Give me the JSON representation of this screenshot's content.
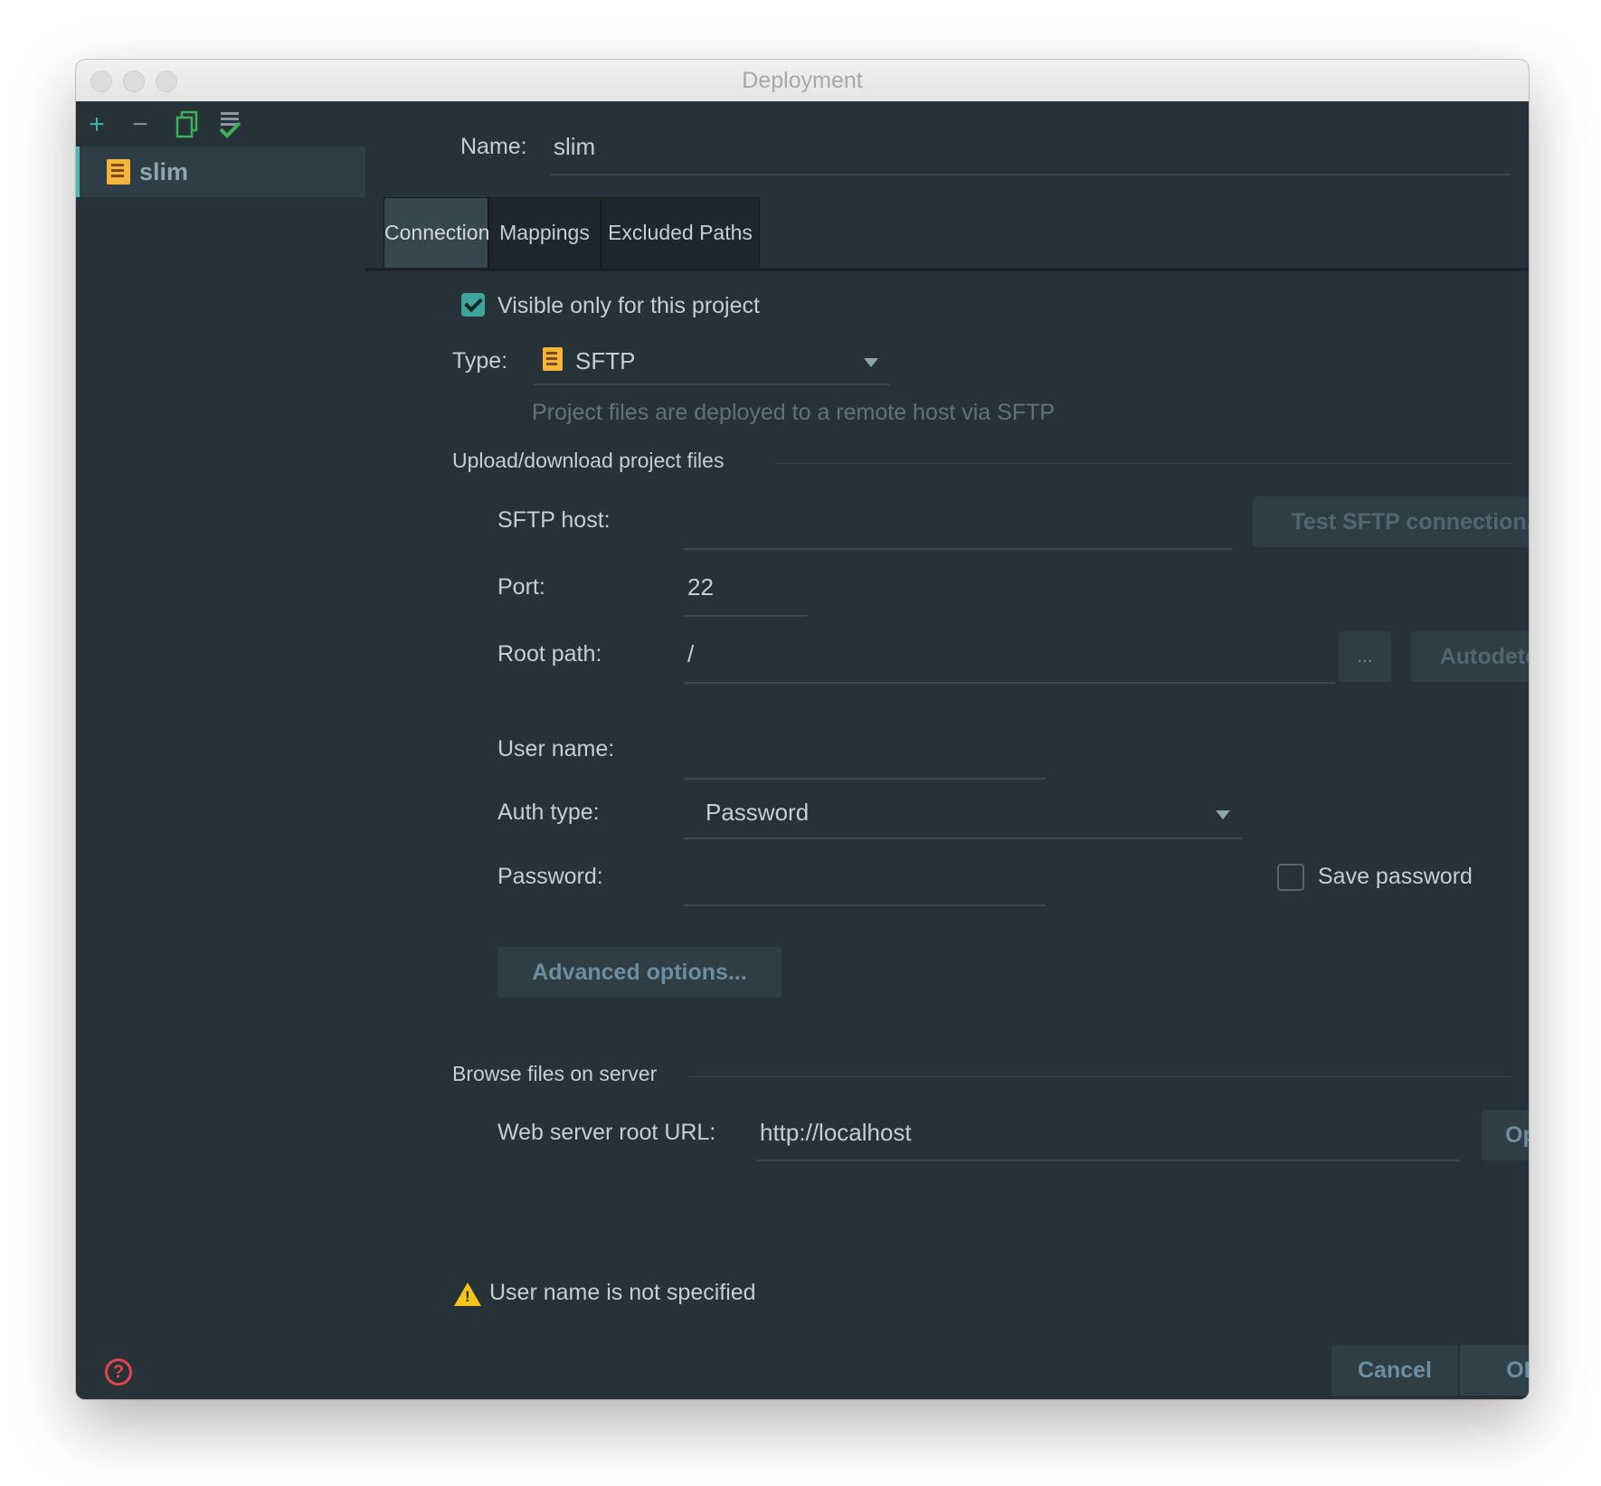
{
  "window": {
    "title": "Deployment"
  },
  "toolbar": {
    "icons": [
      "plus-icon",
      "minus-icon",
      "copy-icon",
      "set-default-icon"
    ],
    "add_glyph": "+",
    "remove_glyph": "−"
  },
  "sidebar": {
    "items": [
      {
        "label": "slim",
        "icon": "sftp-server-icon"
      }
    ]
  },
  "form": {
    "name_label": "Name:",
    "name_value": "slim",
    "tabs": [
      {
        "label": "Connection",
        "active": true
      },
      {
        "label": "Mappings",
        "active": false
      },
      {
        "label": "Excluded Paths",
        "active": false
      }
    ],
    "visible_only_label": "Visible only for this project",
    "visible_only_checked": true,
    "type_label": "Type:",
    "type_value": "SFTP",
    "type_hint": "Project files are deployed to a remote host via SFTP",
    "upload_section": "Upload/download project files",
    "sftp_host_label": "SFTP host:",
    "sftp_host_value": "",
    "test_button": "Test SFTP connection...",
    "port_label": "Port:",
    "port_value": "22",
    "root_path_label": "Root path:",
    "root_path_value": "/",
    "browse_button": "...",
    "autodetect_button": "Autodetect",
    "user_name_label": "User name:",
    "user_name_value": "",
    "auth_type_label": "Auth type:",
    "auth_type_value": "Password",
    "password_label": "Password:",
    "password_value": "",
    "save_password_label": "Save password",
    "save_password_checked": false,
    "advanced_button": "Advanced options...",
    "browse_section": "Browse files on server",
    "web_root_label": "Web server root URL:",
    "web_root_value": "http://localhost",
    "open_button": "Open",
    "warning_text": "User name is not specified"
  },
  "footer": {
    "help_glyph": "?",
    "cancel_button": "Cancel",
    "ok_button": "OK"
  },
  "colors": {
    "background": "#263238",
    "accent": "#4fb8b0",
    "warning": "#f5c518",
    "help": "#e0454f"
  }
}
